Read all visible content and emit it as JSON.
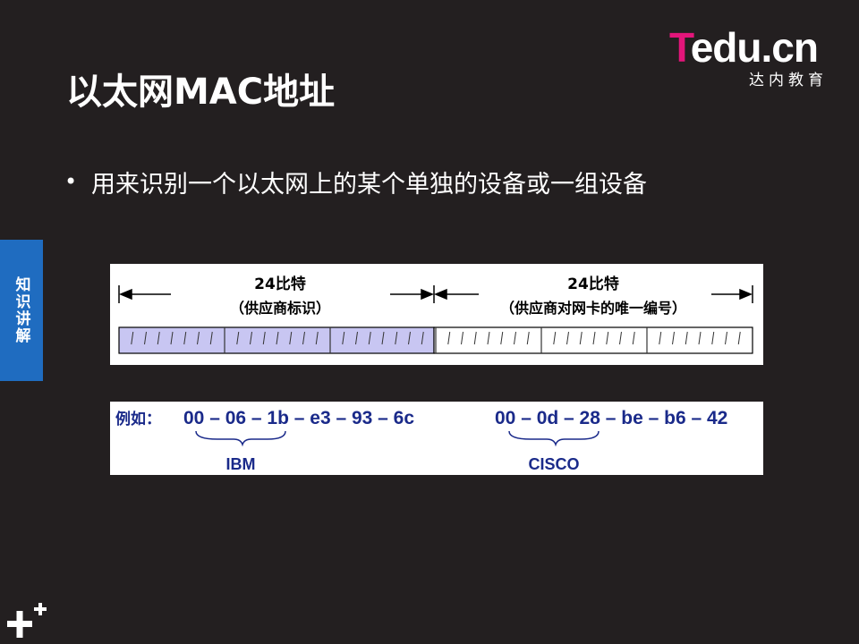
{
  "logo": {
    "brand_t": "T",
    "brand_rest": "edu.cn",
    "subtitle": "达内教育"
  },
  "title": "以太网MAC地址",
  "bullet": "用来识别一个以太网上的某个单独的设备或一组设备",
  "side_tab": "知识讲解",
  "diagram": {
    "left_bits": "24比特",
    "left_desc": "（供应商标识）",
    "right_bits": "24比特",
    "right_desc": "（供应商对网卡的唯一编号）"
  },
  "example": {
    "label": "例如：",
    "mac1": "00 – 06 – 1b – e3 – 93 – 6c",
    "vendor1": "IBM",
    "mac2": "00 – 0d – 28 – be – b6 – 42",
    "vendor2": "CISCO"
  },
  "colors": {
    "accent_pink": "#e3157a",
    "tab_blue": "#1f6cc0",
    "oui_fill": "#c8c6f2",
    "text_blue": "#1a2a8a"
  },
  "icons": [
    "plus-icon"
  ]
}
